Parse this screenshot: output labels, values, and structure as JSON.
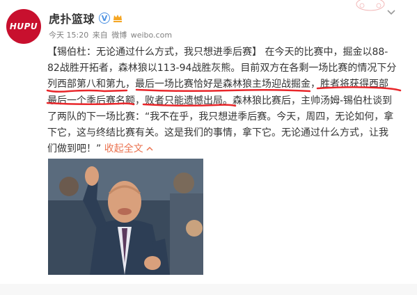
{
  "account": {
    "avatar_text": "HUPU",
    "name": "虎扑篮球",
    "time": "今天 15:20",
    "source_prefix": "来自",
    "source_name": "微博",
    "source_domain": "weibo.com"
  },
  "post": {
    "lines": [
      "【锡伯杜：无论通过什么方式，我只想进季后赛】 在今天的比赛中，掘金以88-",
      "82战胜开拓者，森林狼以113-94战胜灰熊。目前双方在各剩一场比赛的情况下分",
      "列西部第八和第九，最后一场比赛恰好是森林狼主场迎战掘金，胜者将获得西部",
      "最后一个季后赛名额，败者只能遗憾出局。森林狼比赛后，主帅汤姆-锡伯杜谈到",
      "了两队的下一场比赛：“我不在乎，我只想进季后赛。今天，周四，无论如何，拿",
      "下它，这与终结比赛有关。这是我们的事情，拿下它。无论通过什么方式，让我",
      "们做到吧！”"
    ],
    "collapse_label": "收起全文",
    "collapse_icon": "chevron-up-icon"
  },
  "colors": {
    "brand_red": "#c8102e",
    "annotation_red": "#e8262a",
    "link_orange": "#eb7350",
    "meta_gray": "#808080"
  },
  "icons": [
    "verified-icon",
    "vip-icon",
    "chevron-down-icon",
    "chevron-up-icon"
  ]
}
